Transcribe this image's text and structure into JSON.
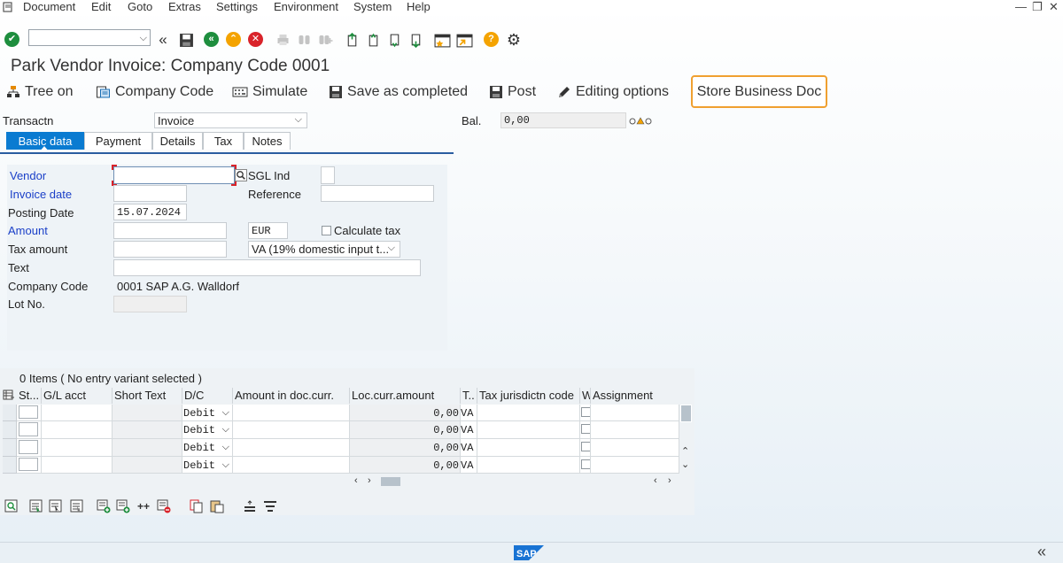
{
  "menu": {
    "items": [
      "Document",
      "Edit",
      "Goto",
      "Extras",
      "Settings",
      "Environment",
      "System",
      "Help"
    ]
  },
  "window_controls": {
    "minimize": "—",
    "restore": "❐",
    "close": "✕"
  },
  "title": "Park Vendor Invoice: Company Code 0001",
  "app_toolbar": {
    "tree_on": "Tree on",
    "company_code": "Company Code",
    "simulate": "Simulate",
    "save_as_completed": "Save as completed",
    "post": "Post",
    "editing_options": "Editing options",
    "store_business_doc": "Store Business Doc"
  },
  "header": {
    "transaction_label": "Transactn",
    "transaction_value": "Invoice",
    "balance_label": "Bal.",
    "balance_value": "0,00"
  },
  "tabs": [
    "Basic data",
    "Payment",
    "Details",
    "Tax",
    "Notes"
  ],
  "form": {
    "vendor_label": "Vendor",
    "vendor_value": "",
    "sgl_label": "SGL Ind",
    "invoice_date_label": "Invoice date",
    "reference_label": "Reference",
    "posting_date_label": "Posting Date",
    "posting_date_value": "15.07.2024",
    "amount_label": "Amount",
    "currency_value": "EUR",
    "calc_tax_label": "Calculate tax",
    "tax_amount_label": "Tax amount",
    "tax_code_value": "VA (19% domestic input t...",
    "text_label": "Text",
    "company_code_label": "Company Code",
    "company_code_value": "0001 SAP A.G. Walldorf",
    "lot_label": "Lot No."
  },
  "items": {
    "summary": "0 Items ( No entry variant selected )",
    "columns": [
      "St...",
      "G/L acct",
      "Short Text",
      "D/C",
      "Amount in doc.curr.",
      "Loc.curr.amount",
      "T..",
      "Tax jurisdictn code",
      "W",
      "Assignment"
    ],
    "rows": [
      {
        "dc": "Debit",
        "loc_amount": "0,00",
        "tax": "VA"
      },
      {
        "dc": "Debit",
        "loc_amount": "0,00",
        "tax": "VA"
      },
      {
        "dc": "Debit",
        "loc_amount": "0,00",
        "tax": "VA"
      },
      {
        "dc": "Debit",
        "loc_amount": "0,00",
        "tax": "VA"
      }
    ]
  },
  "footer": {
    "brand": "SAP"
  },
  "colors": {
    "accent_blue": "#0a7bd1",
    "highlight_orange": "#f0a030",
    "required_blue": "#1a3fc8"
  }
}
